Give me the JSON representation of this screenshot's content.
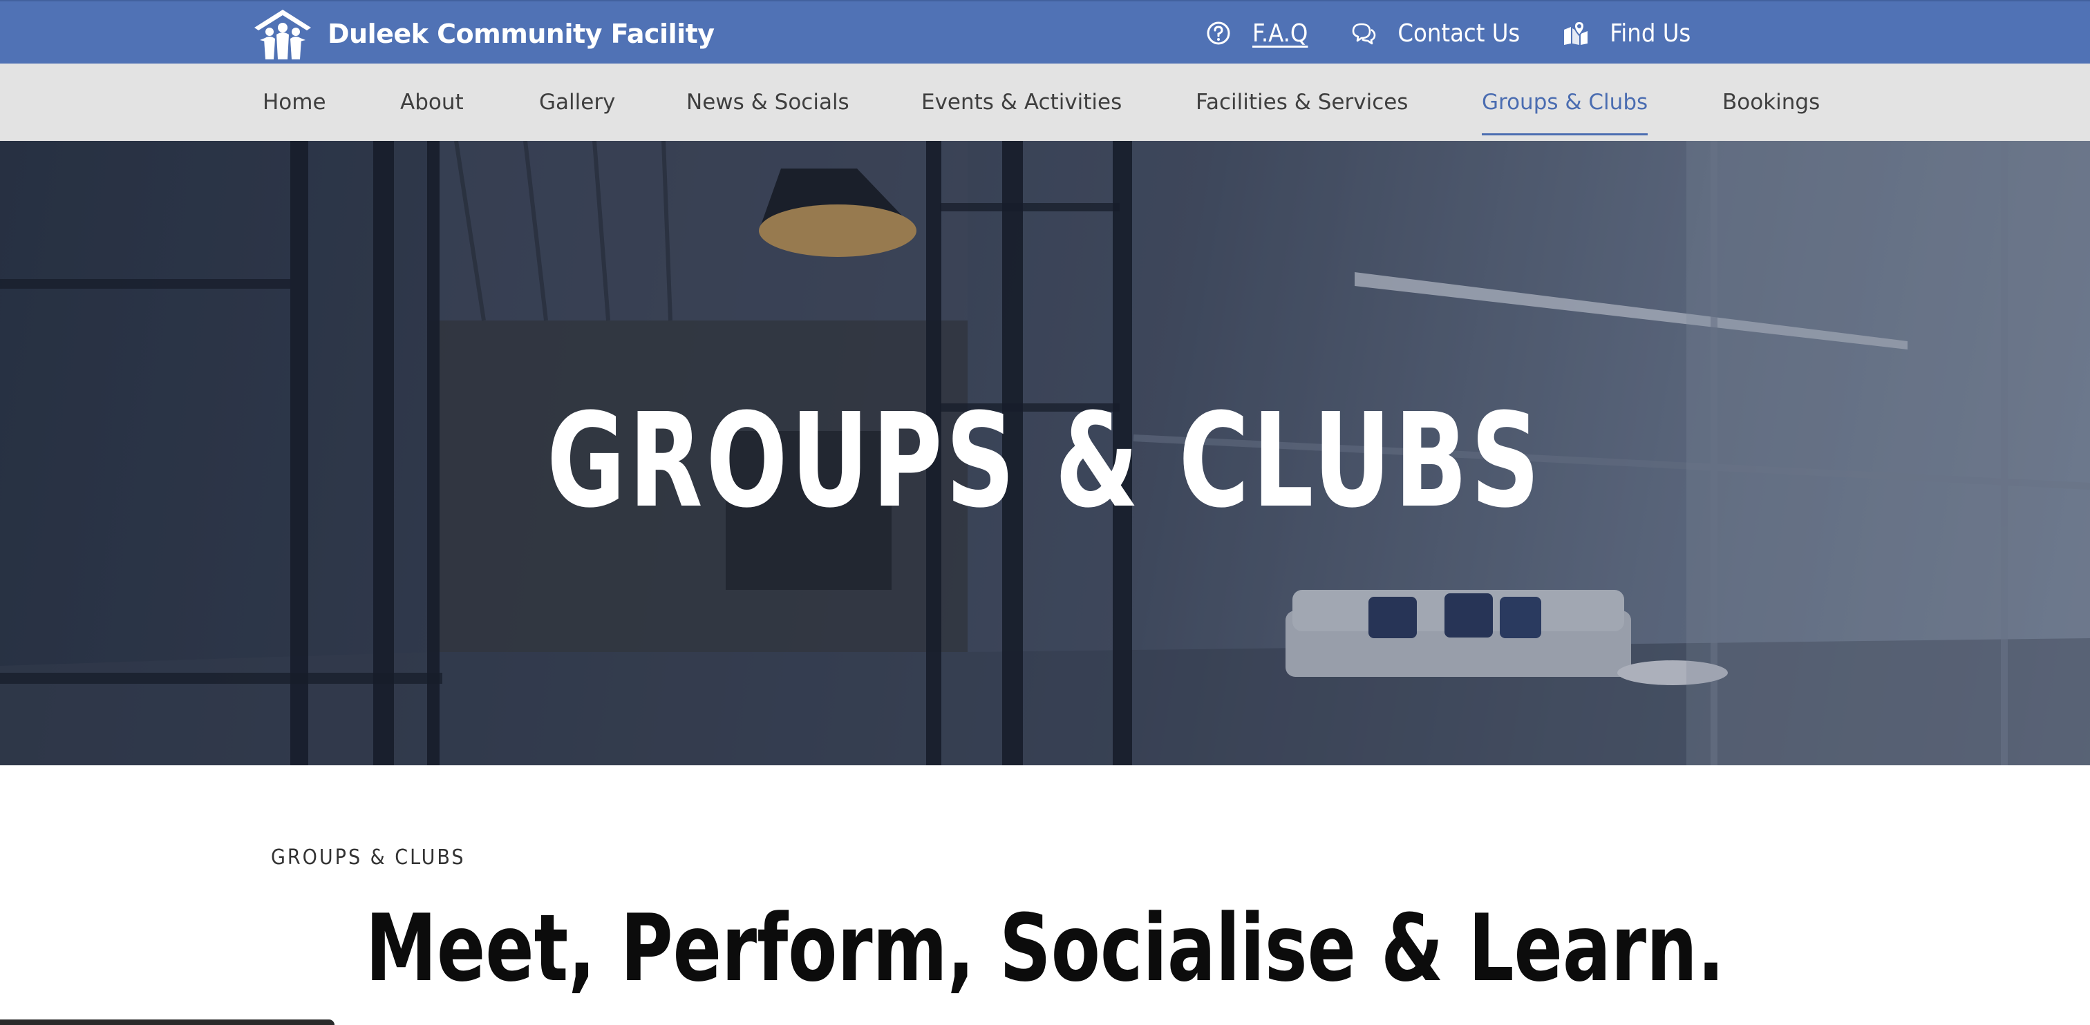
{
  "header": {
    "site_name": "Duleek Community Facility",
    "logo_icon": "community-people-house-icon",
    "utility_links": [
      {
        "label": "F.A.Q",
        "icon": "question-circle-icon"
      },
      {
        "label": "Contact Us",
        "icon": "chat-bubbles-icon"
      },
      {
        "label": "Find Us",
        "icon": "map-pin-icon"
      }
    ],
    "colors": {
      "topbar": "#5072b5",
      "nav_bg": "#e3e3e3",
      "accent": "#4b6db1"
    }
  },
  "nav": {
    "items": [
      {
        "label": "Home",
        "active": false
      },
      {
        "label": "About",
        "active": false
      },
      {
        "label": "Gallery",
        "active": false
      },
      {
        "label": "News & Socials",
        "active": false
      },
      {
        "label": "Events & Activities",
        "active": false
      },
      {
        "label": "Facilities & Services",
        "active": false
      },
      {
        "label": "Groups & Clubs",
        "active": true
      },
      {
        "label": "Bookings",
        "active": false
      }
    ]
  },
  "hero": {
    "title": "GROUPS & CLUBS"
  },
  "intro": {
    "eyebrow": "GROUPS & CLUBS",
    "heading": "Meet, Perform, Socialise & Learn."
  }
}
